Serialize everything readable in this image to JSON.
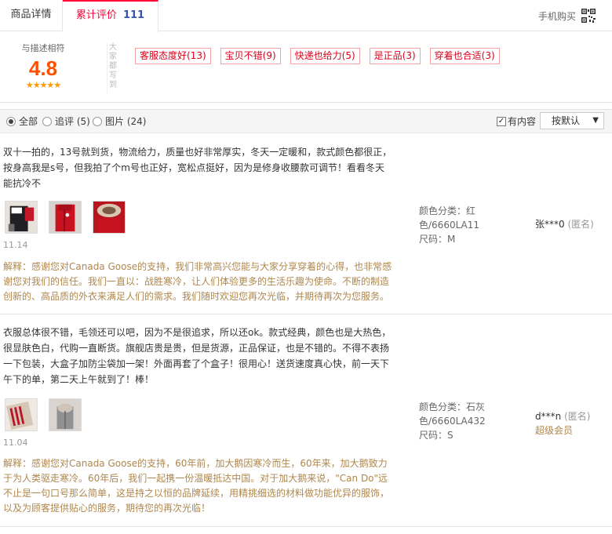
{
  "tabs": {
    "details_label": "商品详情",
    "reviews_label": "累计评价",
    "reviews_count": "111",
    "mobile_buy_label": "手机购买"
  },
  "summary": {
    "caption": "与描述相符",
    "score": "4.8",
    "stars": "★★★★★",
    "vertical_label": "大家都写到",
    "tags": [
      "客服态度好(13)",
      "宝贝不错(9)",
      "快递也给力(5)",
      "是正品(3)",
      "穿着也合适(3)"
    ]
  },
  "filter": {
    "all_label": "全部",
    "followup_label": "追评 (5)",
    "pictures_label": "图片 (24)",
    "has_content_label": "有内容",
    "sort_label": "按默认"
  },
  "reviews": [
    {
      "text": "双十一拍的，13号就到货，物流给力，质量也好非常厚实，冬天一定暖和，款式颜色都很正，按身高我是s号，但我拍了个m号也正好，宽松点挺好，因为是修身收腰款可调节！看看冬天能抗冷不",
      "date": "11.14",
      "reply": "解释：感谢您对Canada Goose的支持，我们非常高兴您能与大家分享穿着的心得，也非常感谢您对我们的信任。我们一直以：战胜寒冷，让人们体验更多的生活乐趣为使命。不断的制造创新的、高品质的外衣来满足人们的需求。我们随时欢迎您再次光临，并期待再次为您服务。",
      "color_label": "颜色分类：红色/6660LA11",
      "size_label": "尺码：M",
      "user": "张***0",
      "anon": "(匿名)",
      "level": ""
    },
    {
      "text": "衣服总体很不错，毛领还可以吧，因为不是很追求，所以还ok。款式经典，颜色也是大热色，很显肤色白，代购一直断货。旗舰店贵是贵，但是货源，正品保证，也是不错的。不得不表扬一下包装，大盒子加防尘袋加一架！外面再套了个盒子！很用心！送货速度真心快，前一天下午下的单，第二天上午就到了！棒！",
      "date": "11.04",
      "reply": "解释：感谢您对Canada Goose的支持，60年前，加大鹅因寒冷而生，60年来，加大鹅致力于为人类驱走寒冷。60年后，我们一起携一份温暖抵达中国。对于加大鹅来说，\"Can Do\"远不止是一句口号那么简单，这是持之以恒的品牌延续，用精挑细选的材料做功能优异的服饰，以及为顾客提供贴心的服务，期待您的再次光临！",
      "color_label": "颜色分类：石灰色/6660LA432",
      "size_label": "尺码：S",
      "user": "d***n",
      "anon": "(匿名)",
      "level": "超级会员"
    }
  ],
  "colors": {
    "accent": "#ff0036",
    "score": "#ff5000",
    "tag_text": "#d9001b",
    "reply_text": "#af874d"
  }
}
